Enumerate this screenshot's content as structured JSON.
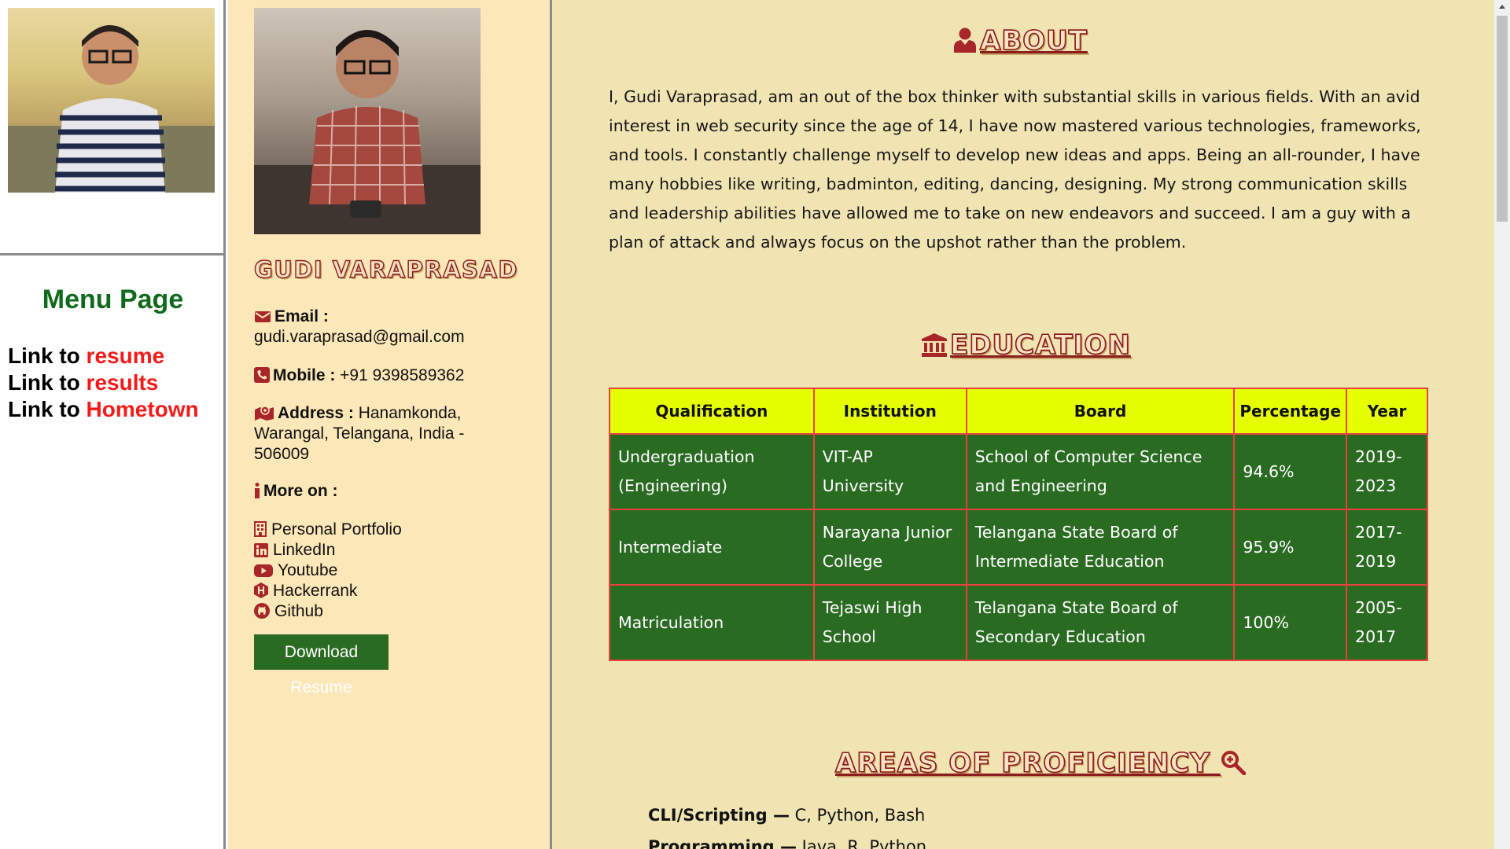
{
  "menu": {
    "title": "Menu Page",
    "links": [
      {
        "prefix": "Link to ",
        "label": "resume"
      },
      {
        "prefix": "Link to ",
        "label": "results"
      },
      {
        "prefix": "Link to ",
        "label": "Hometown"
      }
    ]
  },
  "sidebar": {
    "name": "GUDI VARAPRASAD",
    "email_label": "Email :",
    "email_value": "gudi.varaprasad@gmail.com",
    "mobile_label": "Mobile :",
    "mobile_value": "+91 9398589362",
    "address_label": "Address :",
    "address_value": "Hanamkonda, Warangal, Telangana, India - 506009",
    "more_label": "More on :",
    "more_links": [
      {
        "label": "Personal Portfolio",
        "icon": "building-icon"
      },
      {
        "label": "LinkedIn",
        "icon": "linkedin-icon"
      },
      {
        "label": "Youtube",
        "icon": "youtube-icon"
      },
      {
        "label": "Hackerrank",
        "icon": "hackerrank-icon"
      },
      {
        "label": "Github",
        "icon": "github-icon"
      }
    ],
    "download_label": "Download Resume"
  },
  "main": {
    "about_title": "ABOUT",
    "about_text": "I, Gudi Varaprasad, am an out of the box thinker with substantial skills in various fields. With an avid interest in web security since the age of 14, I have now mastered various technologies, frameworks, and tools. I constantly challenge myself to develop new ideas and apps. Being an all-rounder, I have many hobbies like writing, badminton, editing, dancing, designing. My strong communication skills and leadership abilities have allowed me to take on new endeavors and succeed. I am a guy with a plan of attack and always focus on the upshot rather than the problem.",
    "education_title": "EDUCATION",
    "education_headers": [
      "Qualification",
      "Institution",
      "Board",
      "Percentage",
      "Year"
    ],
    "education_rows": [
      [
        "Undergraduation (Engineering)",
        "VIT-AP University",
        "School of Computer Science and Engineering",
        "94.6%",
        "2019-2023"
      ],
      [
        "Intermediate",
        "Narayana Junior College",
        "Telangana State Board of Intermediate Education",
        "95.9%",
        "2017-2019"
      ],
      [
        "Matriculation",
        "Tejaswi High School",
        "Telangana State Board of Secondary Education",
        "100%",
        "2005-2017"
      ]
    ],
    "proficiency_title": "AREAS OF PROFICIENCY",
    "proficiency": [
      {
        "label": "CLI/Scripting —",
        "value": " C, Python, Bash"
      },
      {
        "label": "Programming —",
        "value": " Java, R, Python"
      }
    ]
  },
  "colors": {
    "accent_red": "#8b1d1d",
    "link_red": "#f51a1a",
    "menu_green": "#0f6b1b",
    "table_green": "#2a6b22",
    "table_header": "#e6ff00",
    "sidebar_bg": "#fbe7b7",
    "main_bg": "#f1e4b3"
  }
}
